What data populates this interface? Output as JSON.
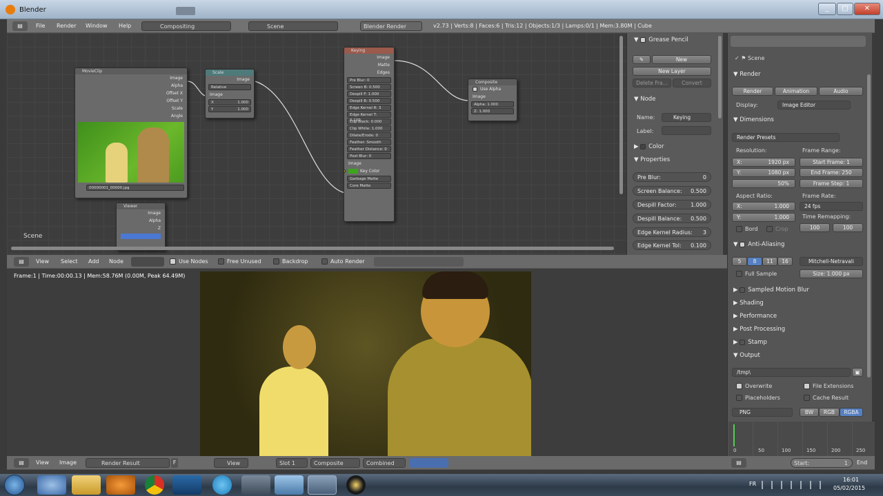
{
  "window": {
    "title": "Blender"
  },
  "top_menu": {
    "items": [
      "File",
      "Render",
      "Window",
      "Help"
    ],
    "screen_layout": "Compositing",
    "scene": "Scene",
    "engine": "Blender Render",
    "stats": "v2.73 | Verts:8 | Faces:6 | Tris:12 | Objects:1/3 | Lamps:0/1 | Mem:3.80M | Cube"
  },
  "node_editor": {
    "scene_label": "Scene",
    "nodes": {
      "movieclip": {
        "title": "MovieClip",
        "outputs": [
          "Image",
          "Alpha",
          "Offset X",
          "Offset Y",
          "Scale",
          "Angle"
        ],
        "clip_name": "00000001_00000.jpg"
      },
      "scale": {
        "title": "Scale",
        "outputs": [
          "Image"
        ],
        "mode": "Relative",
        "inputs": [
          "Image"
        ],
        "x": "1.000",
        "y": "1.000",
        "x_label": "X",
        "y_label": "Y"
      },
      "keying": {
        "title": "Keying",
        "outputs": [
          "Image",
          "Matte",
          "Edges"
        ],
        "params": [
          "Pre Blur: 0",
          "Screen B: 0.500",
          "Despill F: 1.000",
          "Despill B: 0.500",
          "Edge Kernel R: 3",
          "Edge Kernel T: 0.100",
          "Clip Black: 0.000",
          "Clip White: 1.000",
          "Dilate/Erode: 0",
          "Feather: Smooth",
          "Feather Distance: 0",
          "Post Blur: 0"
        ],
        "inputs": [
          "Image",
          "Key Color",
          "Garbage Matte",
          "Core Matte"
        ]
      },
      "composite": {
        "title": "Composite",
        "use_alpha": "Use Alpha",
        "inputs": [
          "Image"
        ],
        "alpha": "Alpha: 1.000",
        "z": "Z: 1.000"
      },
      "viewer": {
        "title": "Viewer",
        "inputs": [
          "Image",
          "Alpha",
          "Z"
        ]
      }
    },
    "header": {
      "menus": [
        "View",
        "Select",
        "Add",
        "Node"
      ],
      "use_nodes": "Use Nodes",
      "free_unused": "Free Unused",
      "backdrop": "Backdrop",
      "auto_render": "Auto Render"
    }
  },
  "node_sidebar": {
    "grease_pencil": "Grease Pencil",
    "new": "New",
    "new_layer": "New Layer",
    "delete_frame": "Delete Fra...",
    "convert": "Convert",
    "node_section": "Node",
    "name_label": "Name:",
    "name_value": "Keying",
    "label_label": "Label:",
    "label_value": "",
    "color_section": "Color",
    "properties_section": "Properties",
    "props": [
      {
        "label": "Pre Blur:",
        "value": "0"
      },
      {
        "label": "Screen Balance:",
        "value": "0.500"
      },
      {
        "label": "Despill Factor:",
        "value": "1.000"
      },
      {
        "label": "Despill Balance:",
        "value": "0.500"
      },
      {
        "label": "Edge Kernel Radius:",
        "value": "3"
      },
      {
        "label": "Edge Kernel Tol:",
        "value": "0.100"
      }
    ]
  },
  "image_viewer": {
    "info": "Frame:1 | Time:00:00.13 | Mem:58.76M (0.00M, Peak 64.49M)",
    "header": {
      "menus": [
        "View",
        "Image"
      ],
      "image_name": "Render Result",
      "f_label": "F",
      "view_menu": "View",
      "slot": "Slot 1",
      "layer": "Composite",
      "pass": "Combined"
    }
  },
  "properties": {
    "scene_label": "Scene",
    "render_section": "Render",
    "render_btn": "Render",
    "animation_btn": "Animation",
    "audio_btn": "Audio",
    "display_label": "Display:",
    "display_value": "Image Editor",
    "dimensions_section": "Dimensions",
    "render_presets": "Render Presets",
    "resolution_label": "Resolution:",
    "res_x": "1920 px",
    "res_y": "1080 px",
    "res_pct": "50%",
    "frame_range_label": "Frame Range:",
    "start_frame": "Start Frame:",
    "start_frame_value": "1",
    "end_frame": "End Frame:",
    "end_frame_value": "250",
    "frame_step": "Frame Step:",
    "frame_step_value": "1",
    "aspect_label": "Aspect Ratio:",
    "aspect_x": "1.000",
    "aspect_y": "1.000",
    "frame_rate_label": "Frame Rate:",
    "frame_rate_value": "24 fps",
    "border": "Bord",
    "crop": "Crop",
    "time_remap_label": "Time Remapping:",
    "remap_old": "100",
    "remap_new": "100",
    "anti_aliasing": "Anti-Aliasing",
    "aa_samples": [
      "5",
      "8",
      "11",
      "16"
    ],
    "aa_filter": "Mitchell-Netravali",
    "full_sample": "Full Sample",
    "size_label": "Size:",
    "size_value": "1.000 px",
    "motion_blur": "Sampled Motion Blur",
    "shading": "Shading",
    "performance": "Performance",
    "post_processing": "Post Processing",
    "stamp": "Stamp",
    "output": "Output",
    "output_path": "/tmp\\",
    "overwrite": "Overwrite",
    "file_extensions": "File Extensions",
    "placeholders": "Placeholders",
    "cache_result": "Cache Result",
    "format": "PNG",
    "bw": "BW",
    "rgb": "RGB",
    "rgba": "RGBA"
  },
  "timeline": {
    "ticks": [
      "0",
      "50",
      "100",
      "150",
      "200",
      "250"
    ],
    "start_label": "Start:",
    "start_value": "1",
    "end_label": "End"
  },
  "taskbar": {
    "lang": "FR",
    "time": "16:01",
    "date": "05/02/2015"
  }
}
